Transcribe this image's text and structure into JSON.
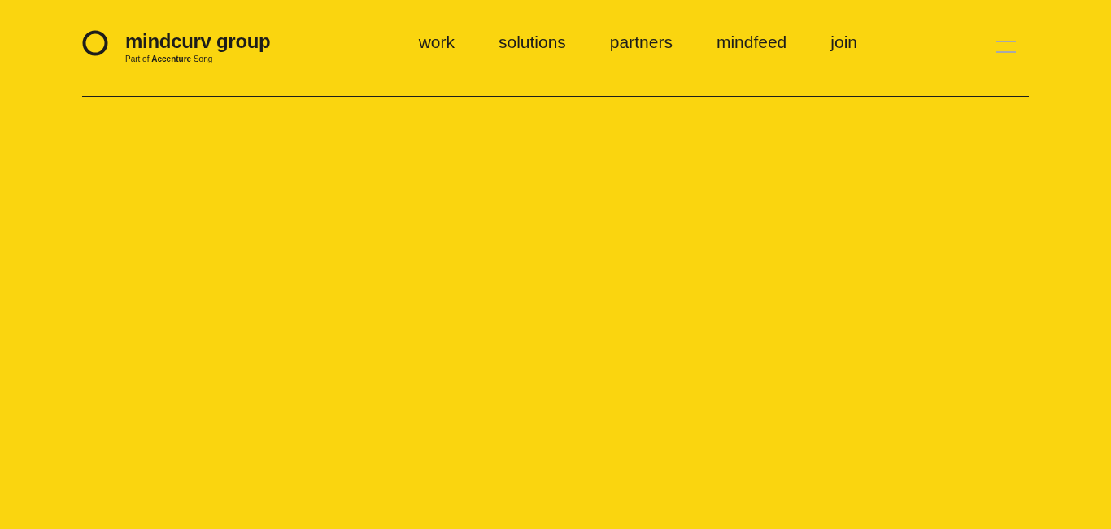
{
  "logo": {
    "name": "mindcurv group",
    "tagline": "Part of **Accenture** Song"
  },
  "nav": [
    {
      "label": "work"
    },
    {
      "label": "solutions"
    },
    {
      "label": "partners"
    },
    {
      "label": "mindfeed"
    },
    {
      "label": "join"
    }
  ]
}
